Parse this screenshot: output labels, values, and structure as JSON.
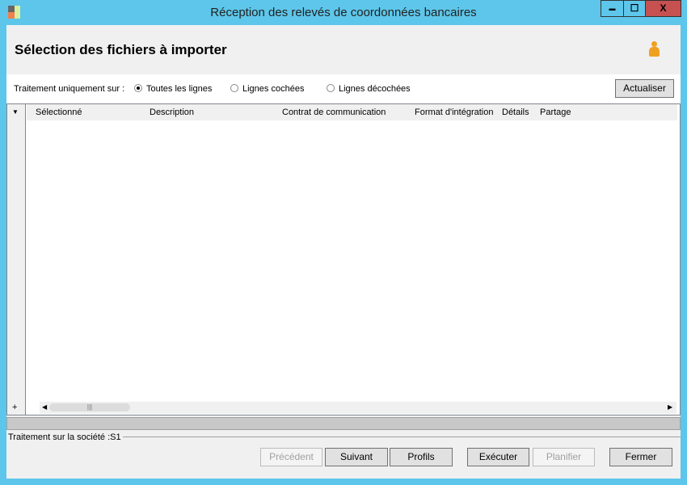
{
  "window": {
    "title": "Réception des relevés de coordonnées bancaires",
    "minimize": "▬",
    "maximize": "☐",
    "close": "X",
    "app_icon": "app-logo-icon"
  },
  "header": {
    "title": "Sélection des fichiers à importer",
    "icon": "user-icon"
  },
  "options": {
    "label": "Traitement uniquement sur :",
    "radios": [
      {
        "label": "Toutes les lignes",
        "checked": true
      },
      {
        "label": "Lignes cochées",
        "checked": false
      },
      {
        "label": "Lignes décochées",
        "checked": false
      }
    ],
    "refresh": "Actualiser"
  },
  "grid": {
    "columns": [
      "Sélectionné",
      "Description",
      "Contrat de communication",
      "Format d'intégration",
      "Détails",
      "Partage"
    ],
    "rows": [],
    "menu_icon": "▼",
    "add_icon": "+"
  },
  "status": {
    "text": "Traitement sur la société :S1"
  },
  "buttons": {
    "previous": "Précédent",
    "next": "Suivant",
    "profiles": "Profils",
    "execute": "Exécuter",
    "schedule": "Planifier",
    "close": "Fermer"
  },
  "colors": {
    "frame": "#5ec6ea",
    "close_button": "#c75050"
  }
}
